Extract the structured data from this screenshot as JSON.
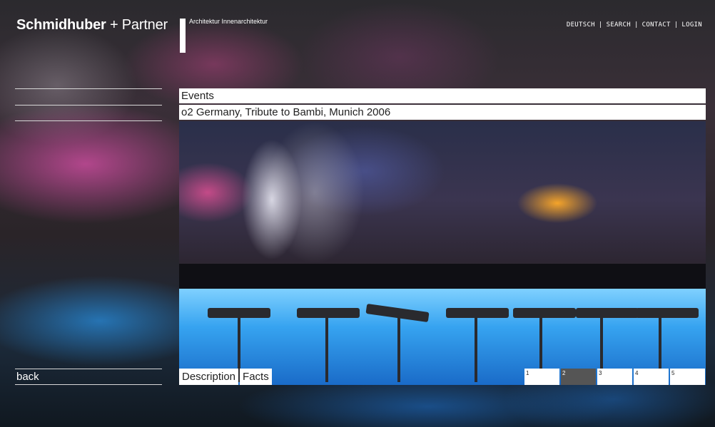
{
  "header": {
    "brand_main": "Schmidhuber",
    "brand_plus": "+",
    "brand_partner": "Partner",
    "tagline": "Architektur  Innenarchitektur"
  },
  "topnav": {
    "items": [
      "DEUTSCH",
      "SEARCH",
      "CONTACT",
      "LOGIN"
    ],
    "separator": "|"
  },
  "content": {
    "category": "Events",
    "project_title": "o2 Germany, Tribute to Bambi,  Munich 2006"
  },
  "tabs": [
    "Description",
    "Facts"
  ],
  "pager": {
    "pages": [
      "1",
      "2",
      "3",
      "4",
      "5"
    ],
    "active": "2"
  },
  "side": {
    "back_label": "back"
  },
  "colors": {
    "panel_bg": "#ffffff",
    "active_page": "#555555",
    "text_dark": "#222222"
  }
}
